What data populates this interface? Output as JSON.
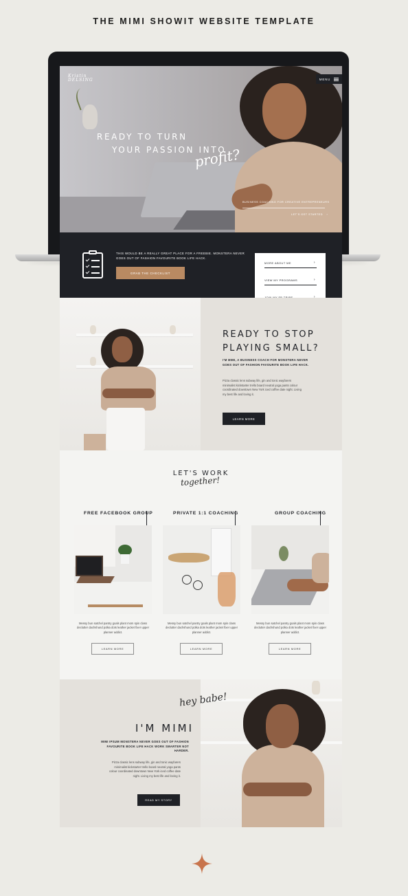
{
  "title": "THE MIMI SHOWIT WEBSITE TEMPLATE",
  "hero": {
    "logo_line1": "Kristin",
    "logo_line2": "DELSING",
    "menu_label": "MENU",
    "headline_line1": "READY TO TURN",
    "headline_line2": "YOUR PASSION INTO",
    "script_word": "profit?",
    "subline": "BUSINESS COACHING FOR CREATIVE ENTREPRENEURS",
    "cta": "LET'S GET STARTED",
    "cta_arrow": "›"
  },
  "freebie": {
    "text": "THIS WOULD BE A REALLY GREAT PLACE FOR A FREEBIE. MONSTERA NEVER GOES OUT OF FASHION FAVOURITE BOOK LIFE HACK.",
    "button": "GRAB THE CHECKLIST",
    "icon": "clipboard-checklist-icon",
    "nav": [
      {
        "label": "MORE ABOUT ME",
        "arrow": "›"
      },
      {
        "label": "VIEW MY PROGRAMS",
        "arrow": "›"
      },
      {
        "label": "JOIN MY FB TRIBE",
        "arrow": "›"
      }
    ]
  },
  "intro": {
    "heading_line1": "READY TO STOP",
    "heading_line2": "PLAYING SMALL?",
    "bold": "I'M MIMI, A BUSINESS COACH FOR MONSTERA NEVER GOES OUT OF FASHION FAVOURITE BOOK LIFE HACK.",
    "body": "Pizza classic lens subway life, gin and tonic wayfarers minimalist kickstarter trello board neutral yoga pants colour coordinated downtown New York iced coffee date night. Living my best life and loving it.",
    "button": "LEARN MORE"
  },
  "services": {
    "heading": "LET'S WORK",
    "script": "together!",
    "items": [
      {
        "title": "FREE FACEBOOK GROUP",
        "desc": "Messy bun satchel pantry goals plant mom spin class declutter dachshund polka dots leather jacket fixer upper planner addict.",
        "button": "LEARN MORE"
      },
      {
        "title": "PRIVATE 1:1 COACHING",
        "desc": "Messy bun satchel pantry goals plant mom spin class declutter dachshund polka dots leather jacket fixer upper planner addict.",
        "button": "LEARN MORE"
      },
      {
        "title": "GROUP COACHING",
        "desc": "Messy bun satchel pantry goals plant mom spin class declutter dachshund polka dots leather jacket fixer upper planner addict.",
        "button": "LEARN MORE"
      }
    ]
  },
  "about": {
    "script": "hey babe!",
    "heading": "I'M MIMI",
    "bold": "MIMI IPSUM MONSTERA NEVER GOES OUT OF FASHION FAVOURITE BOOK LIFE HACK WORK SMARTER NOT HARDER.",
    "body": "Pizza classic lens subway life, gin and tonic wayfarers minimalist kickstarter trello board neutral yoga pants colour coordinated downtown New York iced coffee date night. Living my best life and loving it.",
    "button": "READ MY STORY"
  },
  "colors": {
    "background": "#ecebe6",
    "dark": "#1f2126",
    "accent": "#b98a62",
    "beige": "#e4e1dc",
    "spark": "#c8744c"
  }
}
